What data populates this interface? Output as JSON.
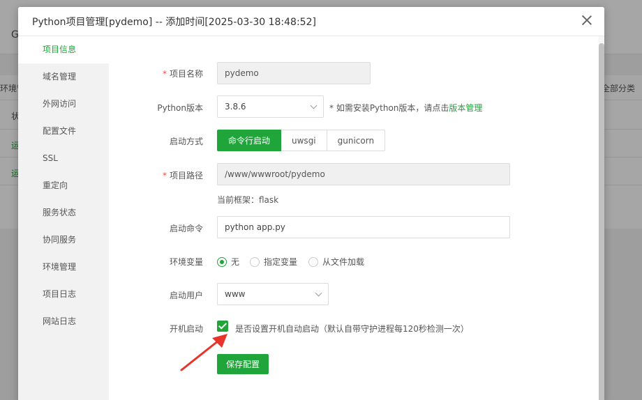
{
  "background": {
    "header_letter": "G",
    "env_col": "环境管",
    "all_categories": "全部分类",
    "row_label": "状",
    "row1": "运",
    "row2": "运"
  },
  "modal": {
    "title": "Python项目管理[pydemo] -- 添加时间[2025-03-30 18:48:52]"
  },
  "sidebar": {
    "items": [
      {
        "label": "项目信息",
        "active": true
      },
      {
        "label": "域名管理"
      },
      {
        "label": "外网访问"
      },
      {
        "label": "配置文件"
      },
      {
        "label": "SSL"
      },
      {
        "label": "重定向"
      },
      {
        "label": "服务状态"
      },
      {
        "label": "协同服务"
      },
      {
        "label": "环境管理"
      },
      {
        "label": "项目日志"
      },
      {
        "label": "网站日志"
      }
    ]
  },
  "form": {
    "required_mark": "*",
    "project_name": {
      "label": "项目名称",
      "value": "pydemo"
    },
    "python_version": {
      "label": "Python版本",
      "value": "3.8.6",
      "hint_prefix": "* 如需安装Python版本，请点击",
      "hint_link": "版本管理"
    },
    "startup_mode": {
      "label": "启动方式",
      "options": [
        "命令行启动",
        "uwsgi",
        "gunicorn"
      ],
      "selected": "命令行启动"
    },
    "project_path": {
      "label": "项目路径",
      "value": "/www/wwwroot/pydemo",
      "framework": "当前框架：flask"
    },
    "startup_command": {
      "label": "启动命令",
      "value": "python app.py"
    },
    "env_vars": {
      "label": "环境变量",
      "options": [
        "无",
        "指定变量",
        "从文件加载"
      ],
      "selected": "无"
    },
    "startup_user": {
      "label": "启动用户",
      "value": "www"
    },
    "autostart": {
      "label": "开机启动",
      "checked": true,
      "text": "是否设置开机自动启动（默认自带守护进程每120秒检测一次）"
    },
    "save_label": "保存配置"
  },
  "colors": {
    "accent": "#20a53a",
    "required": "#f04848",
    "arrow": "#e8342a"
  },
  "icons": [
    "close-icon",
    "chevron-down-icon",
    "check-icon",
    "arrow-annotation-icon"
  ]
}
